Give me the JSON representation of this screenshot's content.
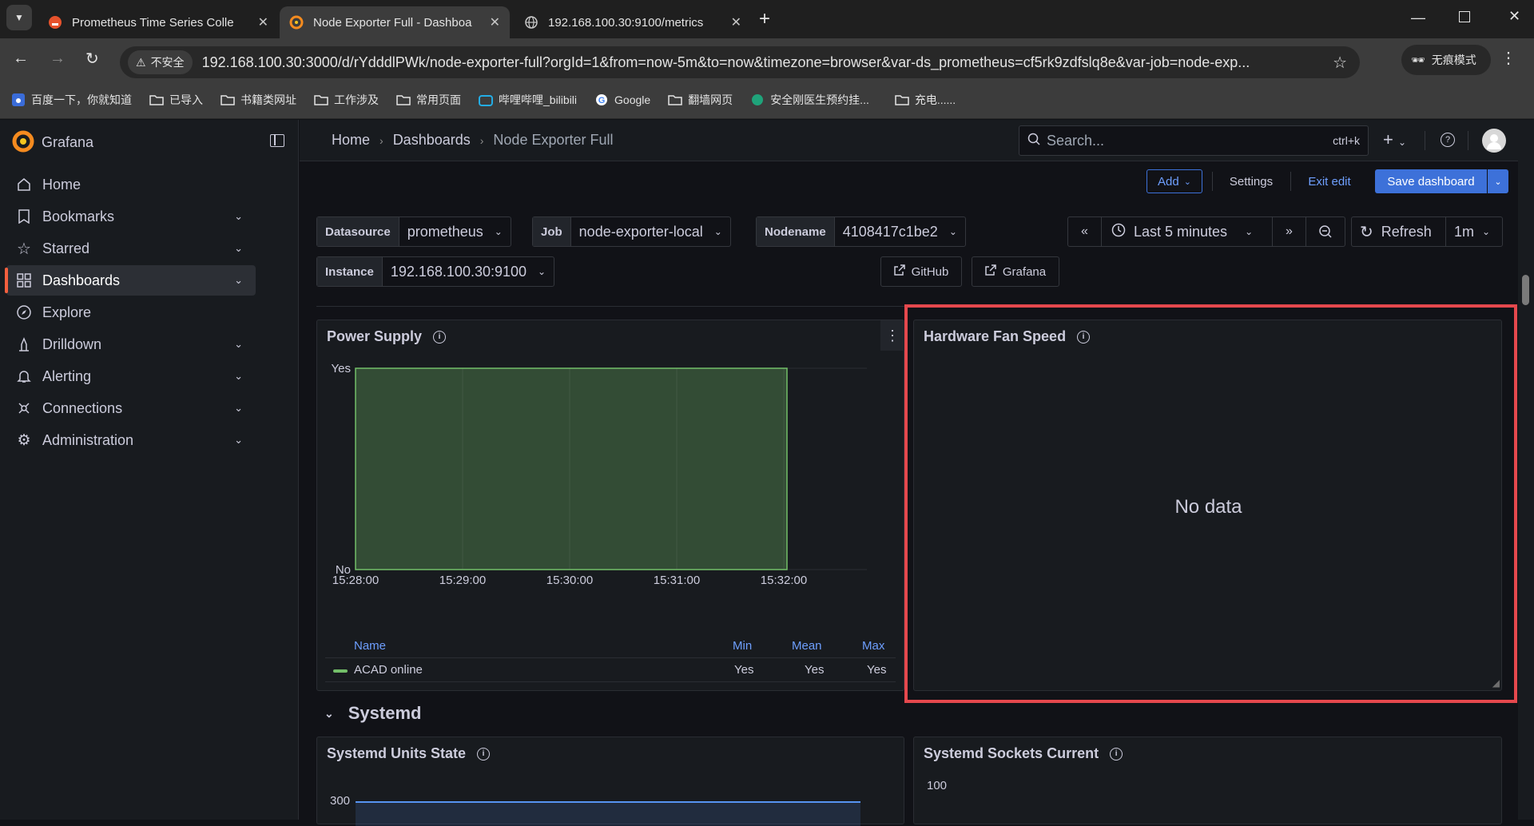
{
  "browser": {
    "tabs": [
      {
        "title": "Prometheus Time Series Colle"
      },
      {
        "title": "Node Exporter Full - Dashboa"
      },
      {
        "title": "192.168.100.30:9100/metrics"
      }
    ],
    "security_label": "不安全",
    "url": "192.168.100.30:3000/d/rYdddlPWk/node-exporter-full?orgId=1&from=now-5m&to=now&timezone=browser&var-ds_prometheus=cf5rk9zdfslq8e&var-job=node-exp...",
    "incognito_label": "无痕模式",
    "bookmarks": [
      {
        "label": "百度一下，你就知道",
        "icon": "baidu-icon"
      },
      {
        "label": "已导入",
        "icon": "folder-icon"
      },
      {
        "label": "书籍类网址",
        "icon": "folder-icon"
      },
      {
        "label": "工作涉及",
        "icon": "folder-icon"
      },
      {
        "label": "常用页面",
        "icon": "folder-icon"
      },
      {
        "label": "哔哩哔哩_bilibili",
        "icon": "bilibili-icon"
      },
      {
        "label": "Google",
        "icon": "google-icon"
      },
      {
        "label": "翻墙网页",
        "icon": "folder-icon"
      },
      {
        "label": "安全刚医生预约挂...",
        "icon": "site-icon"
      },
      {
        "label": "充电......",
        "icon": "folder-icon"
      }
    ]
  },
  "sidebar": {
    "brand": "Grafana",
    "items": [
      {
        "label": "Home",
        "icon": "home-icon"
      },
      {
        "label": "Bookmarks",
        "icon": "bookmark-icon"
      },
      {
        "label": "Starred",
        "icon": "star-icon"
      },
      {
        "label": "Dashboards",
        "icon": "apps-icon"
      },
      {
        "label": "Explore",
        "icon": "compass-icon"
      },
      {
        "label": "Drilldown",
        "icon": "drilldown-icon"
      },
      {
        "label": "Alerting",
        "icon": "bell-icon"
      },
      {
        "label": "Connections",
        "icon": "connections-icon"
      },
      {
        "label": "Administration",
        "icon": "cog-icon"
      }
    ]
  },
  "topnav": {
    "breadcrumb": [
      "Home",
      "Dashboards",
      "Node Exporter Full"
    ],
    "search_placeholder": "Search...",
    "search_shortcut": "ctrl+k"
  },
  "toolbar": {
    "add_label": "Add",
    "settings_label": "Settings",
    "exit_edit_label": "Exit edit",
    "save_label": "Save dashboard"
  },
  "variables": {
    "datasource": {
      "label": "Datasource",
      "value": "prometheus"
    },
    "job": {
      "label": "Job",
      "value": "node-exporter-local"
    },
    "nodename": {
      "label": "Nodename",
      "value": "4108417c1be2"
    },
    "instance": {
      "label": "Instance",
      "value": "192.168.100.30:9100"
    }
  },
  "time": {
    "range_label": "Last 5 minutes",
    "refresh_label": "Refresh",
    "interval": "1m"
  },
  "links": {
    "github": "GitHub",
    "grafana": "Grafana"
  },
  "panels": {
    "power_supply": {
      "title": "Power Supply",
      "legend_headers": {
        "name": "Name",
        "min": "Min",
        "mean": "Mean",
        "max": "Max"
      },
      "legend_row": {
        "name": "ACAD online",
        "min": "Yes",
        "mean": "Yes",
        "max": "Yes"
      }
    },
    "fan_speed": {
      "title": "Hardware Fan Speed",
      "no_data": "No data"
    },
    "row_systemd": "Systemd",
    "systemd_units": {
      "title": "Systemd Units State",
      "y_tick": "300"
    },
    "systemd_sockets": {
      "title": "Systemd Sockets Current",
      "y_tick": "100"
    }
  },
  "chart_data": {
    "type": "area",
    "x": [
      "15:28:00",
      "15:29:00",
      "15:30:00",
      "15:31:00",
      "15:32:00"
    ],
    "yticks": [
      "No",
      "Yes"
    ],
    "series": [
      {
        "name": "ACAD online",
        "values": [
          1,
          1,
          1,
          1,
          1
        ],
        "color": "#73bf69"
      }
    ]
  },
  "colors": {
    "accent": "#3d71d9",
    "highlight": "#e5484d",
    "series": "#73bf69"
  }
}
